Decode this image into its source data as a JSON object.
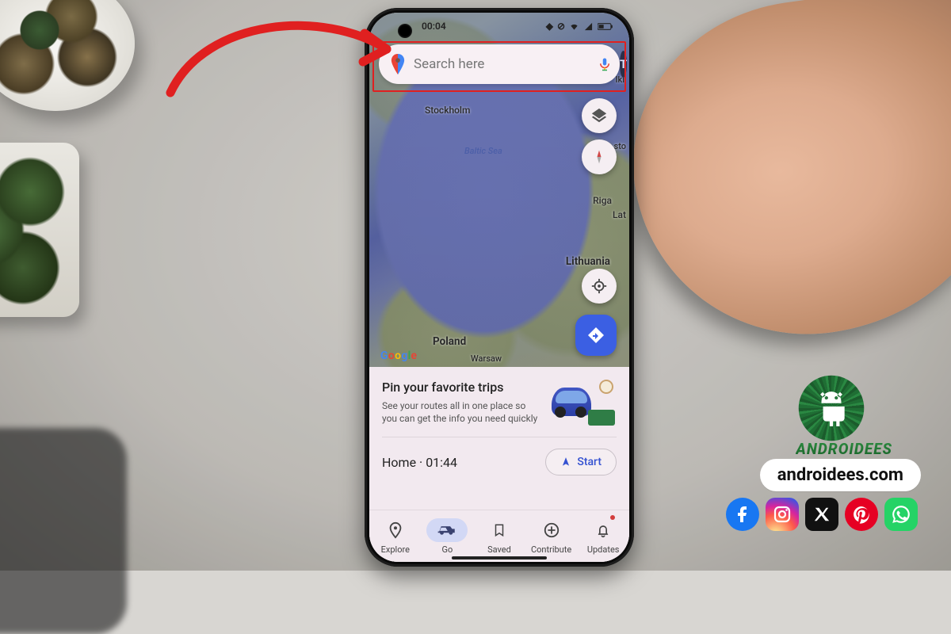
{
  "statusbar": {
    "time": "00:04"
  },
  "search": {
    "placeholder": "Search here"
  },
  "avatar": {
    "initial": "T"
  },
  "map_labels": {
    "baltic_sea": "Baltic Sea",
    "stockholm": "Stockholm",
    "riga": "Riga",
    "lat": "Lat",
    "lithuania": "Lithuania",
    "poland": "Poland",
    "warsaw": "Warsaw",
    "est": "sto",
    "hels": "lki"
  },
  "map_logo": "Google",
  "sheet": {
    "title": "Pin your favorite trips",
    "subtitle": "See your routes all in one place so you can get the info you need quickly",
    "home_label": "Home",
    "home_eta": "01:44",
    "start_label": "Start"
  },
  "nav": {
    "explore": "Explore",
    "go": "Go",
    "saved": "Saved",
    "contribute": "Contribute",
    "updates": "Updates"
  },
  "brand": {
    "name": "ANDROIDEES",
    "url": "androidees.com"
  },
  "colors": {
    "accent_blue": "#3b5fe3",
    "arrow_red": "#e02020",
    "brand_green": "#2a8842"
  }
}
